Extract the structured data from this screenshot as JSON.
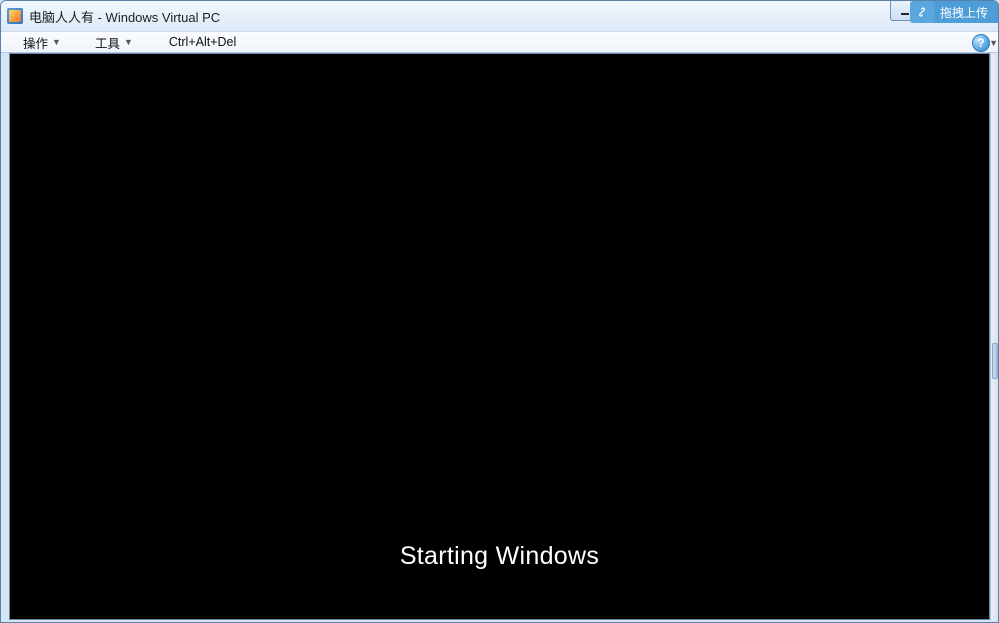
{
  "window": {
    "title": "电脑人人有 - Windows Virtual PC"
  },
  "overlay": {
    "label": "拖拽上传"
  },
  "menubar": {
    "action": "操作",
    "tools": "工具",
    "cad": "Ctrl+Alt+Del",
    "help_symbol": "?"
  },
  "vm": {
    "status_text": "Starting Windows"
  }
}
